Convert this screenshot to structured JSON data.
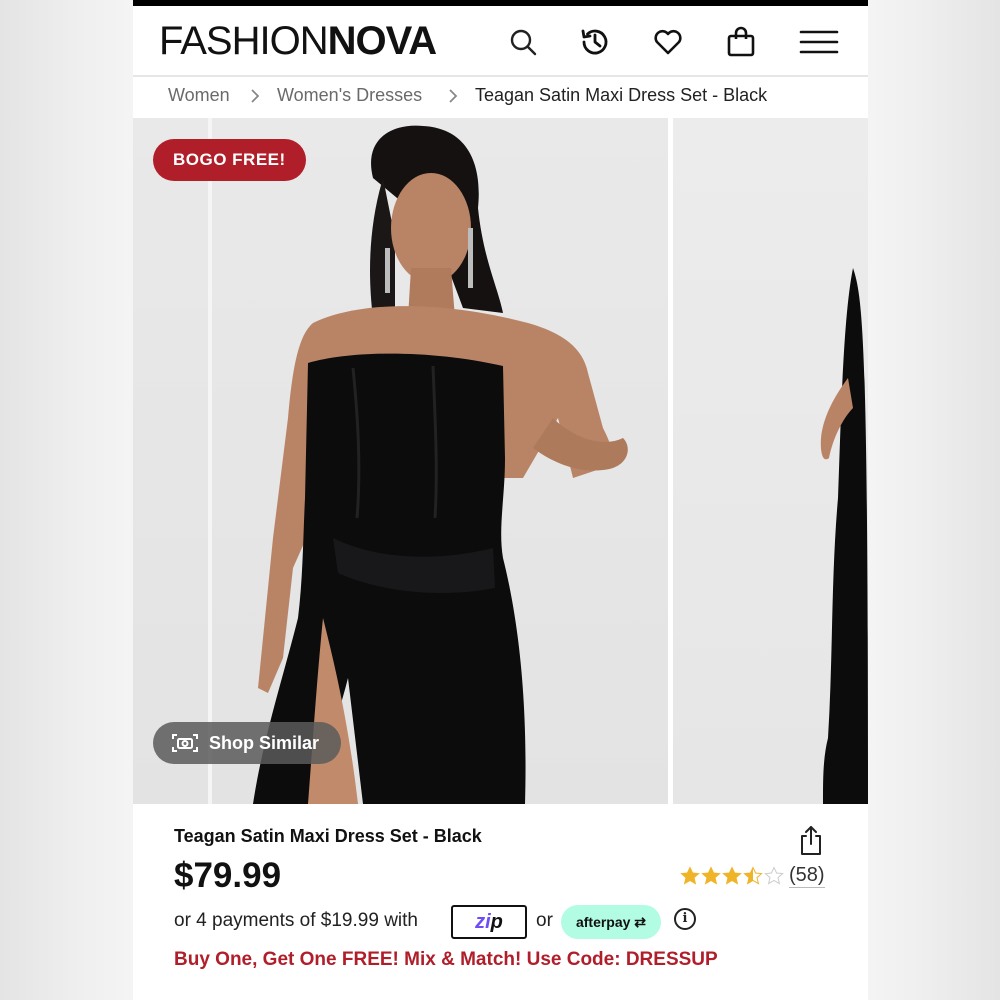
{
  "header": {
    "logo_thin": "FASHION",
    "logo_bold": "NOVA",
    "icons": [
      "search-icon",
      "history-icon",
      "heart-icon",
      "bag-icon",
      "menu-icon"
    ]
  },
  "breadcrumb": {
    "items": [
      "Women",
      "Women's Dresses",
      "Teagan Satin Maxi Dress Set - Black"
    ]
  },
  "gallery": {
    "badge": "BOGO FREE!",
    "shop_similar": "Shop Similar"
  },
  "product": {
    "title": "Teagan Satin Maxi Dress Set - Black",
    "price": "$79.99",
    "rating": 3.5,
    "rating_max": 5,
    "review_count": "(58)",
    "installments": "or 4 payments of $19.99 with",
    "zip_label": "zip",
    "or_text": "or",
    "afterpay_label": "afterpay",
    "promo": "Buy One, Get One FREE! Mix & Match! Use Code: DRESSUP"
  },
  "colors": {
    "brand_red": "#b01e2a",
    "star": "#f0b429",
    "afterpay": "#b2fce4",
    "zip_purple": "#6e4cf6"
  }
}
